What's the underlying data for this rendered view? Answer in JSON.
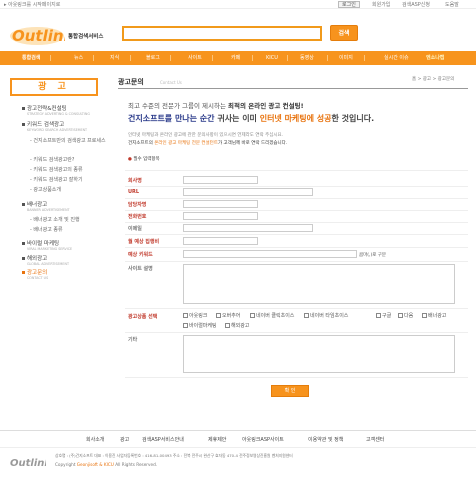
{
  "topbar": {
    "bookmark": "아웃링크를 시작페이지로",
    "login": "로그인",
    "join": "회원가입",
    "asp_apply": "검색ASP신청",
    "help": "도움말"
  },
  "header": {
    "logo_text": "Outlink",
    "service_name": "통합검색서비스",
    "search_placeholder": "",
    "search_button": "검색"
  },
  "nav": {
    "items": [
      "통합검색",
      "뉴스",
      "지식",
      "블로그",
      "사이트",
      "카페",
      "KICU",
      "동영상",
      "이미지",
      "실시간 이슈"
    ],
    "ticker": "엔소나캡"
  },
  "sidebar": {
    "title": "광 고",
    "sections": [
      {
        "label": "광고전략&컨설팅",
        "sub": "STRATEGY ADVERTING & CONSULTING",
        "items": []
      },
      {
        "label": "키워드 검색광고",
        "sub": "KEYWORD SEARCH ADVERTISEMENT",
        "items": [
          "건지소프트만의 검색광고 프로세스",
          "키워드 검색광고란?",
          "키워드 검색광고의 종류",
          "키워드 검색광고 잘하기",
          "광고상품소개"
        ]
      },
      {
        "label": "배너광고",
        "sub": "BANNER ADVERTISEMENT",
        "items": [
          "배너광고 소개 및 진행",
          "배너광고 종류"
        ]
      },
      {
        "label": "바이럴 마케팅",
        "sub": "VIRAL MARKETING SERVICE",
        "items": []
      },
      {
        "label": "해외광고",
        "sub": "GLOBAL ADVERTISEMENT",
        "items": []
      },
      {
        "label": "광고문의",
        "sub": "CONTACT US",
        "items": []
      }
    ]
  },
  "main": {
    "title": "광고문의",
    "title_en": "Contact Us",
    "breadcrumb": "홈 > 광고 > 광고문의",
    "intro1_prefix": "최고 수준의 전문가 그룹이 제시하는 ",
    "intro1_highlight": "최적의 온라인 광고 컨설팅!",
    "intro2_prefix": "건지소프트를 만나는 순간 ",
    "intro2_mid": "귀사는 이미 ",
    "intro2_highlight": "인터넷 마케팅에 성공",
    "intro2_suffix": "한 것입니다.",
    "intro3": "인터넷 마케팅과 온라인 광고에 관한 문의사항이 있으시면 언제라도 연락 주십시요.",
    "intro4_prefix": "건지소프트의 ",
    "intro4_highlight": "온라인 광고 마케팅 전문 컨설턴트",
    "intro4_suffix": "가 고객님께 바로 연락 드리겠습니다.",
    "required_note": "필수 입력항목",
    "fields": {
      "company": "회사명",
      "url": "URL",
      "manager": "담당자명",
      "phone": "전화번호",
      "email": "이메일",
      "budget": "월 예상 집행비",
      "keyword": "예상 키워드",
      "keyword_hint": "콤마(,)로 구분",
      "site_desc": "사이트 설명",
      "products": "광고상품 선택",
      "etc": "기타"
    },
    "product_options": [
      "아웃링크",
      "오버추어",
      "네이버 클릭초이스",
      "네이버 타임초이스",
      "구글",
      "다음",
      "배너광고",
      "바이럴마케팅",
      "해외광고"
    ],
    "submit": "확 인"
  },
  "footer": {
    "links": [
      "회사소개",
      "광고",
      "검색ASP서비스안내",
      "제휴제안",
      "아웃링크ASP사이트",
      "이용약관 및 정책",
      "고객센터"
    ],
    "info1": "상호명 : (주)건지소프트  대표 : 이용진  사업자등록번호 : 416-81-00493  주소 : 전북 전주시 완산구 효자동 470-4 전주정보영상진흥원 벤처지원센터",
    "copyright_prefix": "Copyright ",
    "copyright_company": "Geonjisoft & KICU",
    "copyright_suffix": " All Rights Reserved."
  },
  "colors": {
    "accent": "#f7931d",
    "required": "#c0392b",
    "blue": "#2a3a8a"
  }
}
